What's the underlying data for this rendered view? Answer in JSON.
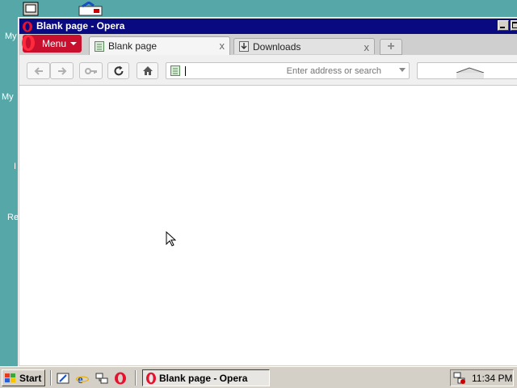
{
  "desktop": {
    "labels": [
      "My",
      "My",
      "I",
      "Re"
    ]
  },
  "window": {
    "title": "Blank page - Opera"
  },
  "browser": {
    "menu_label": "Menu",
    "tabs": [
      {
        "label": "Blank page",
        "active": true
      },
      {
        "label": "Downloads",
        "active": false
      }
    ],
    "close_glyph": "x",
    "newtab_glyph": "+",
    "address": {
      "value": "",
      "placeholder": "Enter address or search"
    }
  },
  "taskbar": {
    "start_label": "Start",
    "task_label": "Blank page - Opera",
    "clock": "11:34 PM"
  },
  "colors": {
    "desktop": "#56a8a8",
    "titlebar": "#0a0a80",
    "opera_red": "#c8102e"
  }
}
